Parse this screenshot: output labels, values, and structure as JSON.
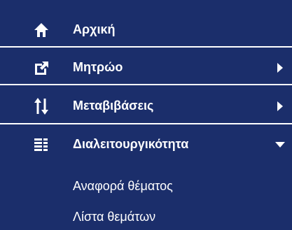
{
  "colors": {
    "background": "#1b2e6b",
    "text": "#ffffff",
    "divider": "#ffffff"
  },
  "menu": {
    "items": [
      {
        "label": "Αρχική",
        "icon": "home-icon"
      },
      {
        "label": "Μητρώο",
        "icon": "external-link-icon",
        "submenu": "collapsed"
      },
      {
        "label": "Μεταβιβάσεις",
        "icon": "transfer-arrows-icon",
        "submenu": "collapsed"
      },
      {
        "label": "Διαλειτουργικότητα",
        "icon": "list-icon",
        "submenu": "expanded",
        "children": [
          {
            "label": "Αναφορά θέματος"
          },
          {
            "label": "Λίστα θεμάτων"
          }
        ]
      }
    ]
  }
}
